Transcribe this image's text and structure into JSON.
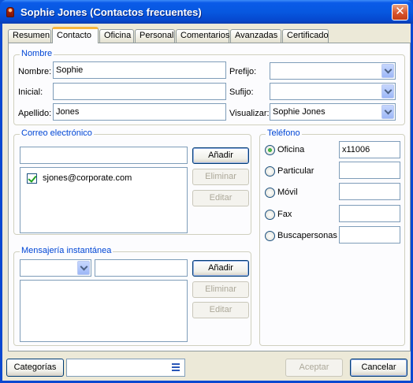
{
  "window": {
    "title": "Sophie Jones (Contactos frecuentes)",
    "close_glyph": "✕"
  },
  "tabs": [
    "Resumen",
    "Contacto",
    "Oficina",
    "Personal",
    "Comentarios",
    "Avanzadas",
    "Certificado"
  ],
  "active_tab": "Contacto",
  "nombre": {
    "group_title": "Nombre",
    "nombre_label": "Nombre:",
    "nombre_value": "Sophie",
    "inicial_label": "Inicial:",
    "inicial_value": "",
    "apellido_label": "Apellido:",
    "apellido_value": "Jones",
    "prefijo_label": "Prefijo:",
    "prefijo_value": "",
    "sufijo_label": "Sufijo:",
    "sufijo_value": "",
    "visualizar_label": "Visualizar:",
    "visualizar_value": "Sophie Jones"
  },
  "correo": {
    "group_title": "Correo electrónico",
    "input_value": "",
    "add_label": "Añadir",
    "remove_label": "Eliminar",
    "edit_label": "Editar",
    "items": [
      {
        "email": "sjones@corporate.com",
        "checked": true
      }
    ]
  },
  "mensajeria": {
    "group_title": "Mensajería instantánea",
    "service_value": "",
    "input_value": "",
    "add_label": "Añadir",
    "remove_label": "Eliminar",
    "edit_label": "Editar"
  },
  "telefono": {
    "group_title": "Teléfono",
    "options": [
      {
        "label": "Oficina",
        "value": "x11006",
        "selected": true
      },
      {
        "label": "Particular",
        "value": "",
        "selected": false
      },
      {
        "label": "Móvil",
        "value": "",
        "selected": false
      },
      {
        "label": "Fax",
        "value": "",
        "selected": false
      },
      {
        "label": "Buscapersonas",
        "value": "",
        "selected": false
      }
    ]
  },
  "footer": {
    "categories_label": "Categorías",
    "categories_value": "",
    "accept_label": "Aceptar",
    "cancel_label": "Cancelar"
  },
  "colors": {
    "titlebar": "#0758e0",
    "group_title": "#0046d5",
    "tab_highlight": "#f7b63e"
  }
}
